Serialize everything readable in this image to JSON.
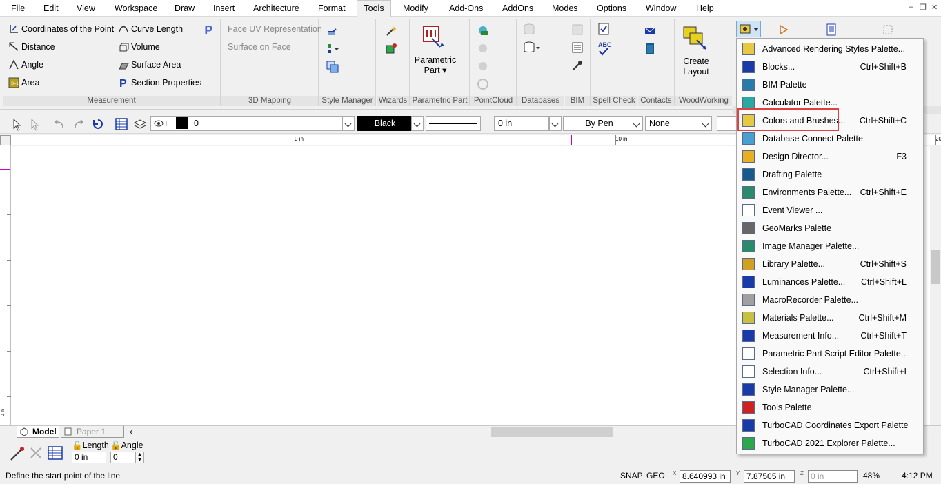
{
  "menubar": {
    "items": [
      "File",
      "Edit",
      "View",
      "Workspace",
      "Draw",
      "Insert",
      "Architecture",
      "Format",
      "Tools",
      "Modify",
      "Add-Ons",
      "AddOns",
      "Modes",
      "Options",
      "Window",
      "Help"
    ],
    "active": "Tools",
    "window_controls": [
      "–",
      "❐",
      "✕"
    ]
  },
  "ribbon": {
    "measurement": {
      "label": "Measurement",
      "items": [
        "Coordinates of the Point",
        "Distance",
        "Angle",
        "Area",
        "Curve Length",
        "Volume",
        "Surface Area",
        "Section Properties"
      ]
    },
    "mapping": {
      "label": "3D Mapping",
      "items": [
        "Face UV Representation",
        "Surface on Face"
      ]
    },
    "style_manager": {
      "label": "Style Manager"
    },
    "wizards": {
      "label": "Wizards"
    },
    "parametric_part": {
      "label": "Parametric Part",
      "button_line1": "Parametric",
      "button_line2": "Part"
    },
    "pointcloud": {
      "label": "PointCloud"
    },
    "databases": {
      "label": "Databases"
    },
    "bim": {
      "label": "BIM"
    },
    "spell_check": {
      "label": "Spell Check",
      "abc": "ABC"
    },
    "contacts": {
      "label": "Contacts"
    },
    "woodworking": {
      "label": "WoodWorking",
      "button_line1": "Create",
      "button_line2": "Layout"
    }
  },
  "toolbar": {
    "layer_value": "0",
    "color_value": "Black",
    "thickness_value": "0 in",
    "pen_value": "By Pen",
    "fill_value": "None"
  },
  "ruler": {
    "label_0": "0 in",
    "label_10": "10 in",
    "label_20": "20",
    "left_label": "0 in"
  },
  "tabs": {
    "model": "Model",
    "paper": "Paper 1"
  },
  "input": {
    "length_label": "Length",
    "angle_label": "Angle",
    "length_value": "0 in",
    "angle_value": "0"
  },
  "status": {
    "prompt": "Define the start point of the line",
    "snap": "SNAP",
    "geo": "GEO",
    "x_value": "8.640993 in",
    "y_value": "7.87505 in",
    "z_value": "0 in",
    "x_label": "X",
    "y_label": "Y",
    "z_label": "Z",
    "zoom": "48%",
    "time": "4:12 PM"
  },
  "palette_menu": {
    "items": [
      {
        "label": "Advanced Rendering Styles Palette...",
        "shortcut": "",
        "icon": "rendering-icon"
      },
      {
        "label": "Blocks...",
        "shortcut": "Ctrl+Shift+B",
        "icon": "blocks-icon"
      },
      {
        "label": "BIM Palette",
        "shortcut": "",
        "icon": "bim-icon"
      },
      {
        "label": "Calculator Palette...",
        "shortcut": "",
        "icon": "calculator-icon"
      },
      {
        "label": "Colors and Brushes...",
        "shortcut": "Ctrl+Shift+C",
        "icon": "palette-icon"
      },
      {
        "label": "Database Connect Palette",
        "shortcut": "",
        "icon": "database-icon"
      },
      {
        "label": "Design Director...",
        "shortcut": "F3",
        "icon": "design-director-icon"
      },
      {
        "label": "Drafting Palette",
        "shortcut": "",
        "icon": "drafting-icon"
      },
      {
        "label": "Environments Palette...",
        "shortcut": "Ctrl+Shift+E",
        "icon": "environment-icon"
      },
      {
        "label": "Event Viewer ...",
        "shortcut": "",
        "icon": "event-viewer-icon"
      },
      {
        "label": "GeoMarks Palette",
        "shortcut": "",
        "icon": "geomarks-icon"
      },
      {
        "label": "Image Manager Palette...",
        "shortcut": "",
        "icon": "image-manager-icon"
      },
      {
        "label": "Library Palette...",
        "shortcut": "Ctrl+Shift+S",
        "icon": "library-icon"
      },
      {
        "label": "Luminances Palette...",
        "shortcut": "Ctrl+Shift+L",
        "icon": "luminance-icon"
      },
      {
        "label": "MacroRecorder Palette...",
        "shortcut": "",
        "icon": "macro-recorder-icon"
      },
      {
        "label": "Materials Palette...",
        "shortcut": "Ctrl+Shift+M",
        "icon": "materials-icon"
      },
      {
        "label": "Measurement Info...",
        "shortcut": "Ctrl+Shift+T",
        "icon": "measurement-icon"
      },
      {
        "label": "Parametric Part Script Editor Palette...",
        "shortcut": "",
        "icon": "script-editor-icon"
      },
      {
        "label": "Selection Info...",
        "shortcut": "Ctrl+Shift+I",
        "icon": "selection-icon"
      },
      {
        "label": "Style Manager Palette...",
        "shortcut": "",
        "icon": "style-manager-icon"
      },
      {
        "label": "Tools Palette",
        "shortcut": "",
        "icon": "tools-icon"
      },
      {
        "label": "TurboCAD Coordinates Export Palette",
        "shortcut": "",
        "icon": "coordinates-export-icon"
      },
      {
        "label": "TurboCAD 2021 Explorer Palette...",
        "shortcut": "",
        "icon": "explorer-icon"
      }
    ]
  },
  "colors": {
    "highlight": "#e04040",
    "ruler_magenta": "#cc00cc",
    "accent_blue": "#1a3aa8"
  }
}
